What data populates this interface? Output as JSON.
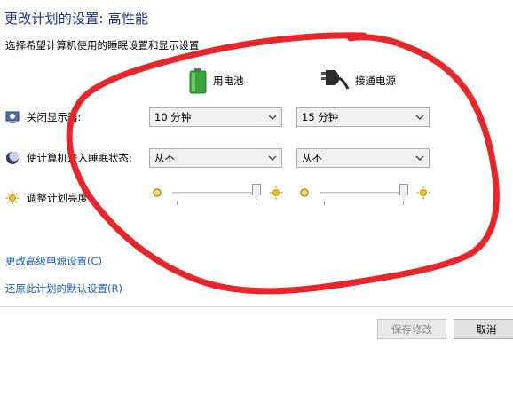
{
  "page": {
    "title": "更改计划的设置: 高性能",
    "subtitle": "选择希望计算机使用的睡眠设置和显示设置"
  },
  "columns": {
    "battery_label": "用电池",
    "battery_icon": "battery-icon",
    "plugged_label": "接通电源",
    "plugged_icon": "power-plug-icon"
  },
  "settings": {
    "display_off": {
      "label": "关闭显示器:",
      "icon": "monitor-clock-icon",
      "battery_value": "10 分钟",
      "plugged_value": "15 分钟"
    },
    "sleep": {
      "label": "使计算机进入睡眠状态:",
      "icon": "moon-sleep-icon",
      "battery_value": "从不",
      "plugged_value": "从不"
    },
    "brightness": {
      "label": "调整计划亮度:",
      "icon": "sun-brightness-icon",
      "battery_level": 1.0,
      "plugged_level": 1.0
    }
  },
  "links": {
    "advanced": "更改高级电源设置(C)",
    "restore": "还原此计划的默认设置(R)"
  },
  "buttons": {
    "save": "保存修改",
    "cancel": "取消"
  },
  "colors": {
    "title": "#1e3287",
    "link": "#1a5fb4",
    "annotation": "#e8262a"
  }
}
